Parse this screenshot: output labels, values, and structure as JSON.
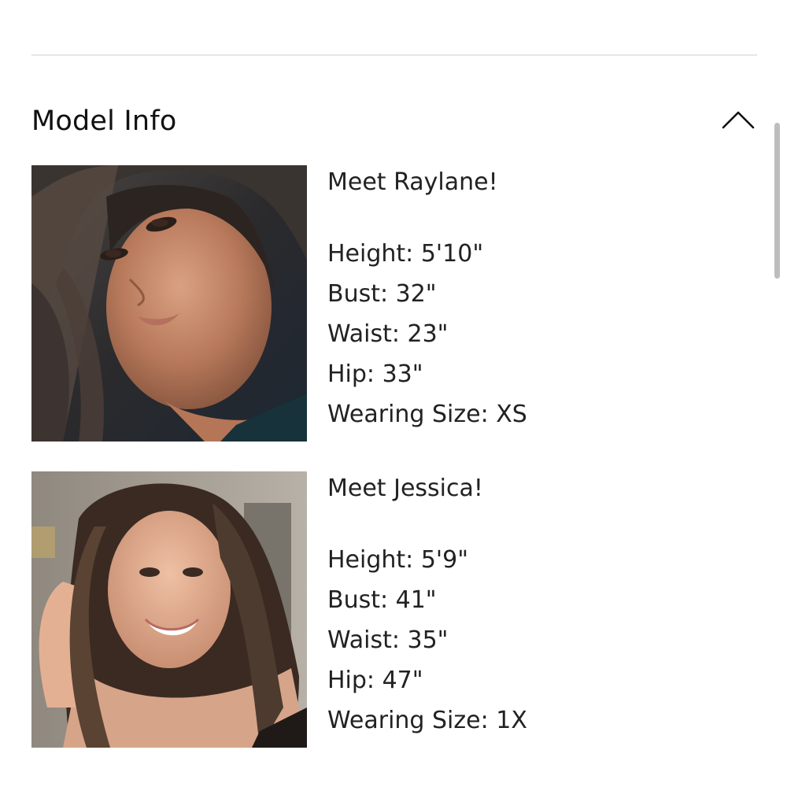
{
  "section": {
    "title": "Model Info",
    "toggle_icon": "chevron-up-icon"
  },
  "models": [
    {
      "name": "Raylane",
      "greeting": "Meet Raylane!",
      "photo_alt": "Raylane",
      "stats": [
        "Height: 5'10\"",
        "Bust: 32\"",
        "Waist: 23\"",
        "Hip: 33\"",
        "Wearing Size: XS"
      ]
    },
    {
      "name": "Jessica",
      "greeting": "Meet Jessica!",
      "photo_alt": "Jessica",
      "stats": [
        "Height: 5'9\"",
        "Bust: 41\"",
        "Waist: 35\"",
        "Hip: 47\"",
        "Wearing Size: 1X"
      ]
    }
  ],
  "colors": {
    "divider": "#e6e6e6",
    "text": "#222222",
    "scrollbar": "#bdbdbd"
  }
}
